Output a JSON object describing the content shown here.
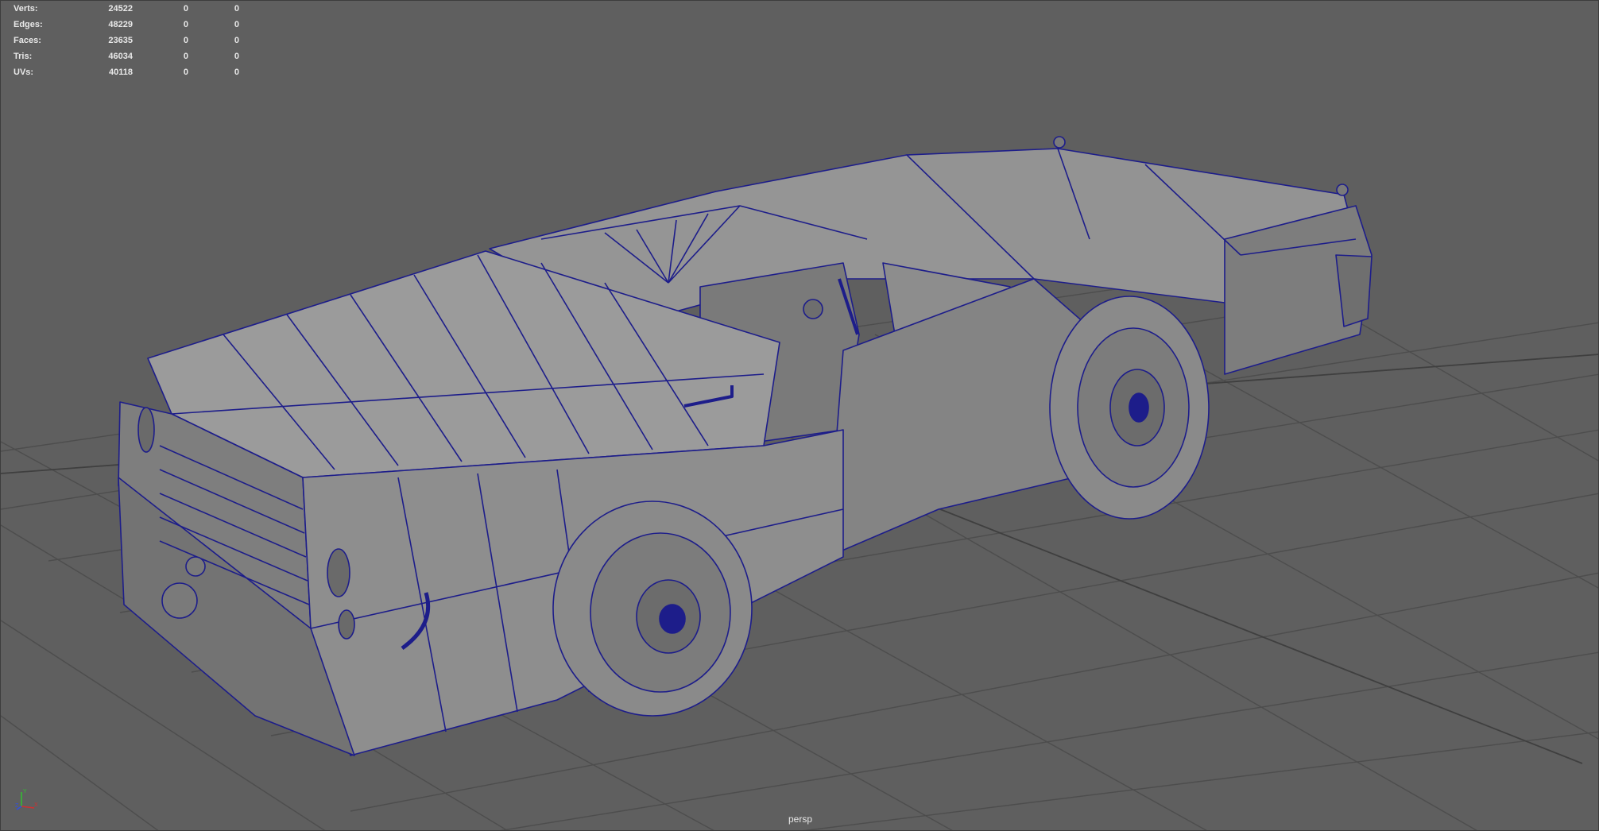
{
  "hud": {
    "rows": [
      {
        "label": "Verts:",
        "value": "24522",
        "sel": "0",
        "comp": "0"
      },
      {
        "label": "Edges:",
        "value": "48229",
        "sel": "0",
        "comp": "0"
      },
      {
        "label": "Faces:",
        "value": "23635",
        "sel": "0",
        "comp": "0"
      },
      {
        "label": "Tris:",
        "value": "46034",
        "sel": "0",
        "comp": "0"
      },
      {
        "label": "UVs:",
        "value": "40118",
        "sel": "0",
        "comp": "0"
      }
    ]
  },
  "camera_label": "persp",
  "axis": {
    "y": "Y",
    "x": "X",
    "z": "Z"
  },
  "colors": {
    "background": "#5f5f5f",
    "grid": "#4d4d4d",
    "grid_axis": "#3f3f3f",
    "wire": "#1d1d8a",
    "body": "#8b8b8b",
    "body_light": "#a0a0a0",
    "body_dark": "#767676"
  }
}
